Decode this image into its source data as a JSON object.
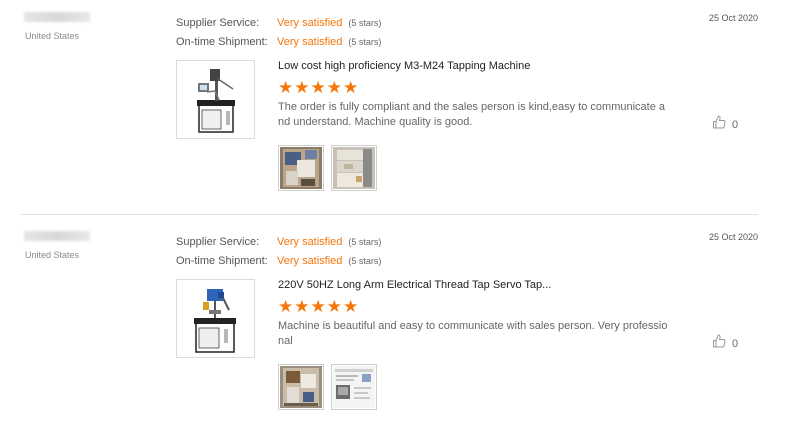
{
  "reviews": [
    {
      "buyer_country": "United States",
      "supplier_service": {
        "label": "Supplier Service:",
        "value": "Very satisfied",
        "stars_text": "(5 stars)"
      },
      "ontime_shipment": {
        "label": "On-time Shipment:",
        "value": "Very satisfied",
        "stars_text": "(5 stars)"
      },
      "date": "25 Oct 2020",
      "product_title": "Low cost high proficiency M3-M24 Tapping Machine",
      "rating": 5,
      "comment": "The order is fully compliant and the sales person is kind,easy to communicate and understand. Machine quality is good.",
      "likes": "0",
      "product_thumb_icon": "tapping-machine-gray-icon",
      "photos": [
        "box-photo-icon",
        "crate-photo-icon"
      ]
    },
    {
      "buyer_country": "United States",
      "supplier_service": {
        "label": "Supplier Service:",
        "value": "Very satisfied",
        "stars_text": "(5 stars)"
      },
      "ontime_shipment": {
        "label": "On-time Shipment:",
        "value": "Very satisfied",
        "stars_text": "(5 stars)"
      },
      "date": "25 Oct 2020",
      "product_title": "220V 50HZ Long Arm Electrical Thread Tap Servo Tap...",
      "rating": 5,
      "comment": "Machine is beautiful and easy to communicate with sales person. Very professional",
      "likes": "0",
      "product_thumb_icon": "tapping-machine-blue-icon",
      "photos": [
        "package-photo-icon",
        "screenshot-photo-icon"
      ]
    }
  ],
  "colors": {
    "accent": "#f5760a",
    "star": "#f5760a",
    "divider": "#e3e3e3"
  }
}
